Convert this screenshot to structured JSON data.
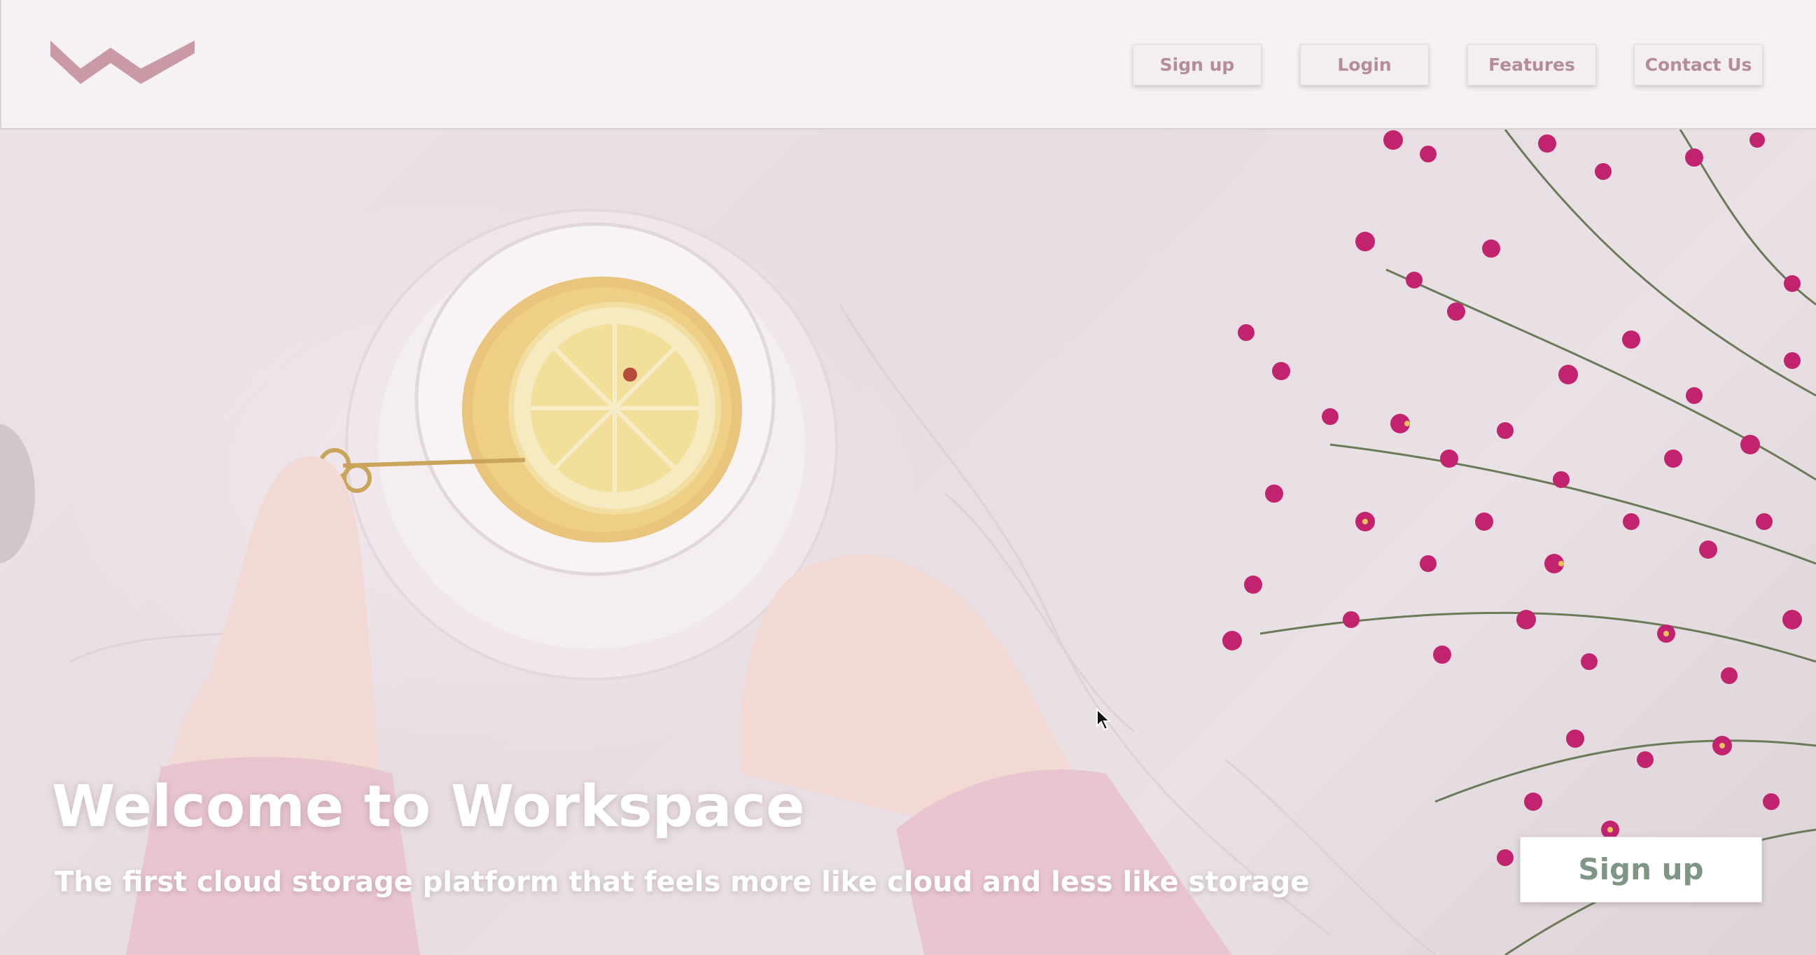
{
  "header": {
    "logo_icon": "workspace-w-logo",
    "nav": {
      "signup_label": "Sign up",
      "login_label": "Login",
      "features_label": "Features",
      "contact_label": "Contact Us"
    }
  },
  "hero": {
    "title": "Welcome to Workspace",
    "subtitle": "The first cloud storage platform that feels more like cloud and less like storage",
    "signup_label": "Sign up"
  },
  "colors": {
    "brand": "#c99aa6",
    "nav_text": "#b58c99",
    "cta_text": "#7f9585",
    "header_bg": "#f5f1f4",
    "hero_bg": "#e9dfe4"
  }
}
